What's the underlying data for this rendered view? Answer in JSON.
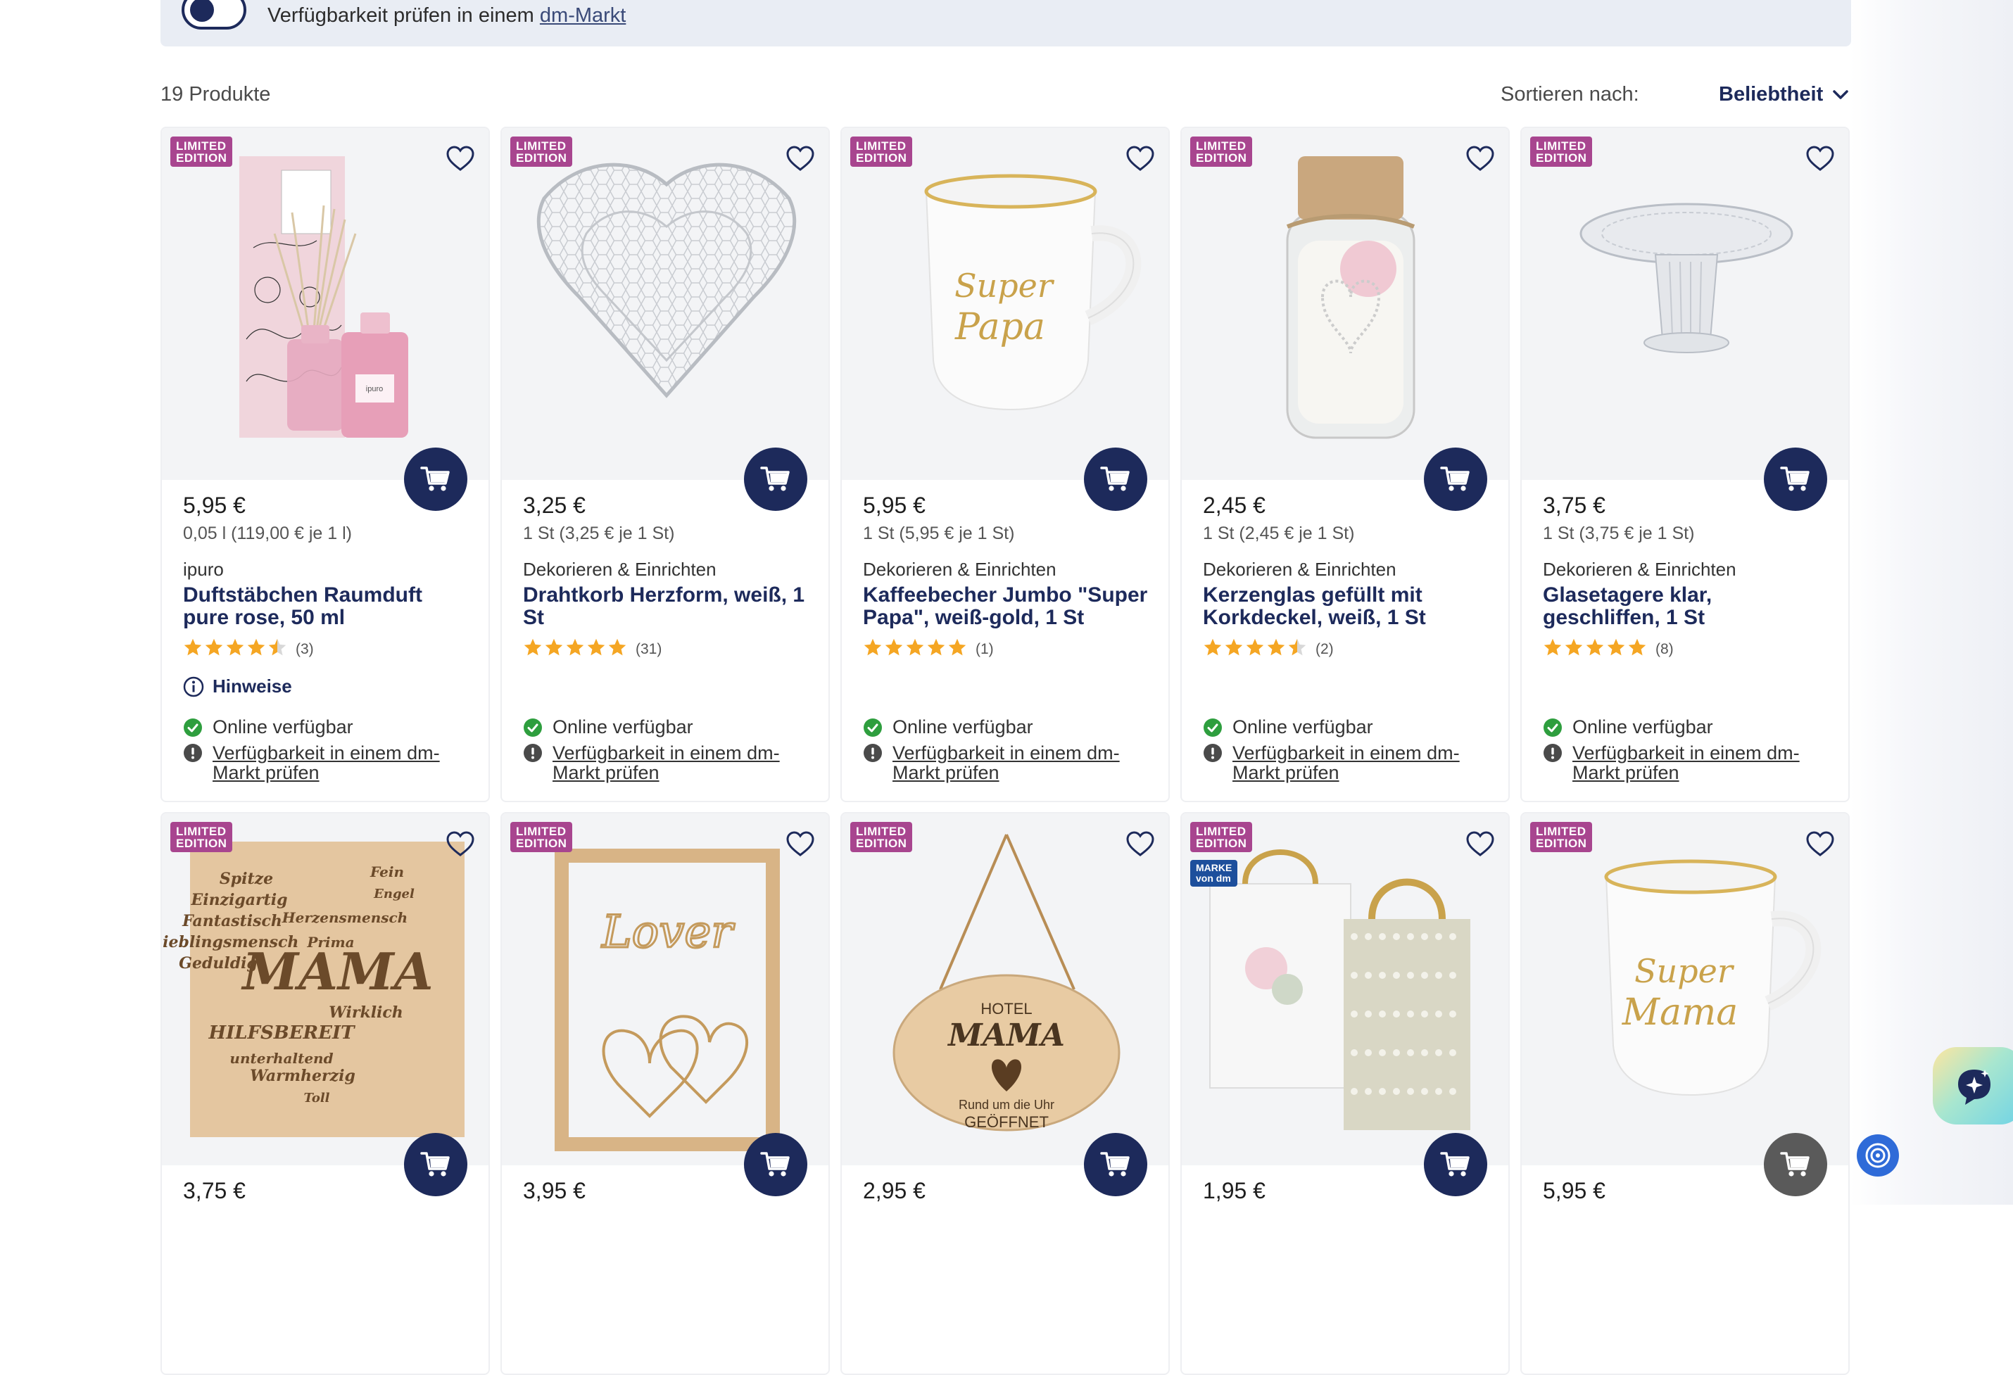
{
  "availability_banner": {
    "text": "Verfügbarkeit prüfen in einem",
    "link": "dm-Markt"
  },
  "toolbar": {
    "product_count": "19 Produkte",
    "sort_label": "Sortieren nach:",
    "sort_value": "Beliebtheit"
  },
  "colors": {
    "brand_navy": "#1d2a5b",
    "limited_badge": "#a8458f",
    "star": "#f5a623",
    "available_green": "#2e9e3e"
  },
  "badge": {
    "line1": "LIMITED",
    "line2": "EDITION",
    "marke_line1": "MARKE",
    "marke_line2": "von dm"
  },
  "products_row1": [
    {
      "price": "5,95 €",
      "unit": "0,05 l (119,00 € je 1 l)",
      "brand": "ipuro",
      "name": "Duftstäbchen Raumduft pure rose, 50 ml",
      "rating": 4.5,
      "reviews": "(3)",
      "hinweise": "Hinweise",
      "online": "Online verfügbar",
      "store_check": "Verfügbarkeit in einem dm-Markt prüfen",
      "image": "ipuro-diffuser"
    },
    {
      "price": "3,25 €",
      "unit": "1 St (3,25 € je 1 St)",
      "brand": "Dekorieren & Einrichten",
      "name": "Drahtkorb Herzform, weiß, 1 St",
      "rating": 5,
      "reviews": "(31)",
      "online": "Online verfügbar",
      "store_check": "Verfügbarkeit in einem dm-Markt prüfen",
      "image": "wire-heart-basket"
    },
    {
      "price": "5,95 €",
      "unit": "1 St (5,95 € je 1 St)",
      "brand": "Dekorieren & Einrichten",
      "name": "Kaffeebecher Jumbo \"Super Papa\", weiß-gold, 1 St",
      "rating": 5,
      "reviews": "(1)",
      "online": "Online verfügbar",
      "store_check": "Verfügbarkeit in einem dm-Markt prüfen",
      "image": "mug-super-papa",
      "mug_text_1": "Super",
      "mug_text_2": "Papa"
    },
    {
      "price": "2,45 €",
      "unit": "1 St (2,45 € je 1 St)",
      "brand": "Dekorieren & Einrichten",
      "name": "Kerzenglas gefüllt mit Korkdeckel, weiß, 1 St",
      "rating": 4.5,
      "reviews": "(2)",
      "online": "Online verfügbar",
      "store_check": "Verfügbarkeit in einem dm-Markt prüfen",
      "image": "candle-jar-cork"
    },
    {
      "price": "3,75 €",
      "unit": "1 St (3,75 € je 1 St)",
      "brand": "Dekorieren & Einrichten",
      "name": "Glasetagere klar, geschliffen, 1 St",
      "rating": 5,
      "reviews": "(8)",
      "online": "Online verfügbar",
      "store_check": "Verfügbarkeit in einem dm-Markt prüfen",
      "image": "glass-cake-stand"
    }
  ],
  "products_row2": [
    {
      "price": "3,75 €",
      "image": "wooden-mama-board"
    },
    {
      "price": "3,95 €",
      "image": "wood-frame-love-hearts",
      "frame_text": "Lover"
    },
    {
      "price": "2,95 €",
      "image": "hotel-mama-sign",
      "sign_1": "HOTEL",
      "sign_2": "MAMA",
      "sign_3": "Rund um die Uhr",
      "sign_4": "GEÖFFNET"
    },
    {
      "price": "1,95 €",
      "image": "gift-bags",
      "marke": true
    },
    {
      "price": "5,95 €",
      "image": "mug-super-mama",
      "mug_text_1": "Super",
      "mug_text_2": "Mama",
      "cart_grey": true
    }
  ],
  "mama_board_words": [
    "Spitze",
    "Fein",
    "Einzigartig",
    "Engel",
    "Fantastisch",
    "Herzensmensch",
    "Lieblingsmensch",
    "Prima",
    "Geduldig",
    "MAMA",
    "Wirklich",
    "HILFSBEREIT",
    "unterhaltend",
    "Warmherzig",
    "Toll"
  ]
}
